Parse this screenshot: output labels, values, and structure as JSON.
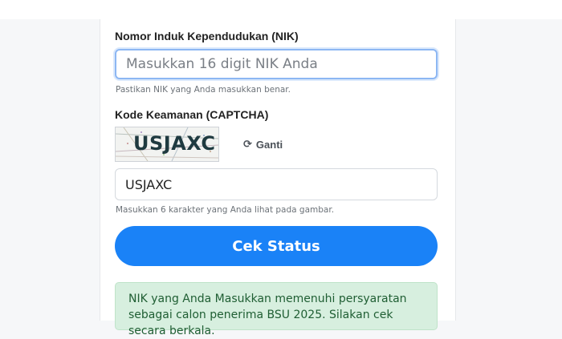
{
  "form": {
    "nik_label": "Nomor Induk Kependudukan (NIK)",
    "nik_placeholder": "Masukkan 16 digit NIK Anda",
    "nik_value": "",
    "nik_help": "Pastikan NIK yang Anda masukkan benar.",
    "captcha_label": "Kode Keamanan (CAPTCHA)",
    "captcha_image_text": "USJAXC",
    "refresh_label": "Ganti",
    "captcha_value": "USJAXC",
    "captcha_help": "Masukkan 6 karakter yang Anda lihat pada gambar.",
    "submit_label": "Cek Status"
  },
  "result": {
    "message": "NIK yang Anda Masukkan memenuhi persyaratan sebagai calon penerima BSU 2025. Silakan cek secara berkala."
  },
  "colors": {
    "primary": "#1a82f7",
    "success_bg": "#d7efdf",
    "success_text": "#1f5e33"
  },
  "icons": {
    "refresh": "refresh-icon"
  }
}
